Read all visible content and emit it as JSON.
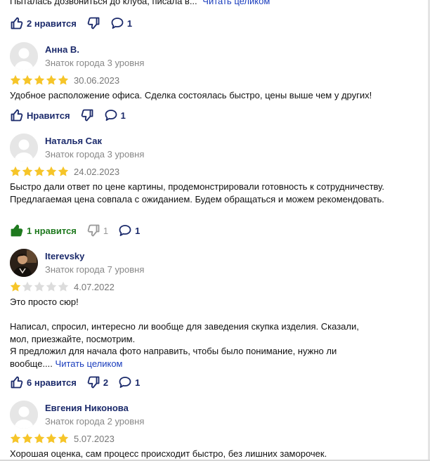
{
  "top_review": {
    "text": "Пыталась дозвониться до клуба, писала в...",
    "more": "Читать целиком",
    "likes": "2 нравится",
    "comments": "1"
  },
  "reviews": [
    {
      "name": "Анна В.",
      "level": "Знаток города 3 уровня",
      "rating": 5,
      "date": "30.06.2023",
      "paragraphs": [
        "Удобное расположение офиса. Сделка состоялась быстро, цены выше чем у других!"
      ],
      "likes": "Нравится",
      "comments": "1"
    },
    {
      "name": "Наталья Сак",
      "level": "Знаток города 3 уровня",
      "rating": 5,
      "date": "24.02.2023",
      "paragraphs": [
        "Быстро дали ответ по цене картины, продемонстрировали готовность к сотрудничеству. Предлагаемая цена совпала с ожиданием. Будем обращаться и можем рекомендовать."
      ],
      "likes": "1 нравится",
      "dislikes": "1",
      "comments": "1"
    },
    {
      "name": "Iterevsky",
      "level": "Знаток города 7 уровня",
      "rating": 1,
      "date": "4.07.2022",
      "paragraphs": [
        "Это просто сюр!",
        "Написал, спросил, интересно ли вообще для заведения скупка изделия. Сказали, мол, приезжайте, посмотрим.",
        "Я предложил для начала фото направить, чтобы было понимание, нужно ли вообще...."
      ],
      "more": "Читать целиком",
      "likes": "6 нравится",
      "dislikes": "2",
      "comments": "1"
    },
    {
      "name": "Евгения Никонова",
      "level": "Знаток города 2 уровня",
      "rating": 5,
      "date": "5.07.2023",
      "paragraphs": [
        "Хорошая оценка, сам процесс происходит быстро, без лишних заморочек."
      ]
    }
  ],
  "colors": {
    "star": "#f6c529",
    "star_empty": "#dcdcdc",
    "link": "#1a3dbd",
    "action": "#1b2a6b",
    "liked": "#1f7a1f"
  },
  "icons": {
    "like": "thumb-up-icon",
    "dislike": "thumb-down-icon",
    "comment": "speech-bubble-icon",
    "star": "star-icon"
  }
}
